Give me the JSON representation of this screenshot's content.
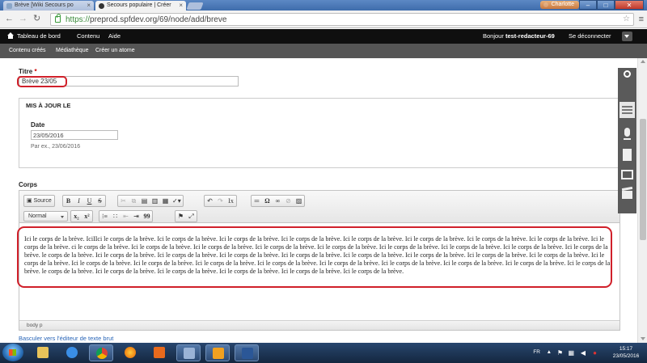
{
  "browser": {
    "tabs": [
      {
        "label": "Brève [Wiki Secours po",
        "active": false
      },
      {
        "label": "Secours populaire | Créer",
        "active": true
      }
    ],
    "user": "Charlotte",
    "url_scheme": "https://",
    "url_rest": "preprod.spfdev.org/69/node/add/breve"
  },
  "admin": {
    "items": [
      "Tableau de bord",
      "Contenu",
      "Aide"
    ],
    "hello_prefix": "Bonjour",
    "username": "test-redacteur-69",
    "logout": "Se déconnecter"
  },
  "shortcuts": [
    "Contenu créés",
    "Médiathèque",
    "Créer un atome"
  ],
  "form": {
    "title_label": "Titre",
    "title_required": "*",
    "title_value": "Brève 23/05",
    "fieldset_legend": "MIS À JOUR LE",
    "date_label": "Date",
    "date_value": "23/05/2016",
    "date_hint": "Par ex., 23/06/2016",
    "body_label": "Corps",
    "body_text": "Ici le corps de la brève. IciIIci le corps de la brève. Ici le corps de la brève. Ici le corps de la brève. Ici le corps de la brève. Ici le corps de la brève. Ici le corps de la brève. Ici le corps de la brève. Ici le corps de la brève. Ici le corps de la brève. ci le corps de la brève. Ici le corps de la brève. Ici le corps de la brève. Ici le corps de la brève. Ici le corps de la brève. Ici le corps de la brève. Ici le corps de la brève. Ici le corps de la brève. Ici le corps de la brève. le corps de la brève. Ici le corps de la brève. Ici le corps de la brève. Ici le corps de la brève. Ici le corps de la brève. Ici le corps de la brève. Ici le corps de la brève. Ici le corps de la brève. Ici le corps de la brève. Ici le corps de la brève. Ici le corps de la brève. Ici le corps de la brève. Ici le corps de la brève. Ici le corps de la brève. Ici le corps de la brève. Ici le corps de la brève. Ici le corps de la brève. Ici le corps de la brève. Ici le corps de la brève.  le corps de la brève. Ici le corps de la brève. Ici le corps de la brève. Ici le corps de la brève. Ici le corps de la brève. Ici le corps de la brève.",
    "elements_path": "body  p",
    "switch_link": "Basculer vers l'éditeur de texte brut"
  },
  "editor_toolbar": {
    "source": "Source",
    "format": "Normal",
    "buttons": [
      "B",
      "I",
      "U",
      "S",
      "Ω",
      "99"
    ]
  },
  "taskbar": {
    "lang": "FR",
    "time": "15:17",
    "date": "23/05/2016"
  }
}
